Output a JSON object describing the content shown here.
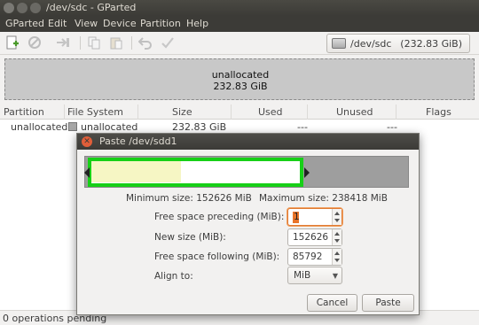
{
  "window": {
    "title": "/dev/sdc - GParted"
  },
  "menu": [
    "GParted",
    "Edit",
    "View",
    "Device",
    "Partition",
    "Help"
  ],
  "toolbar": {
    "icons": [
      "new-partition-icon",
      "delete-icon",
      "resize-move-icon",
      "copy-icon",
      "paste-icon",
      "undo-icon",
      "apply-icon"
    ],
    "device": "/dev/sdc",
    "device_size": "(232.83 GiB)"
  },
  "partition_map": {
    "label": "unallocated",
    "size": "232.83 GiB"
  },
  "table": {
    "headers": [
      "Partition",
      "File System",
      "Size",
      "Used",
      "Unused",
      "Flags"
    ],
    "rows": [
      {
        "partition": "unallocated",
        "filesystem": "unallocated",
        "size": "232.83 GiB",
        "used": "---",
        "unused": "---",
        "flags": ""
      }
    ]
  },
  "status": "0 operations pending",
  "dialog": {
    "title": "Paste /dev/sdd1",
    "min_size": "Minimum size: 152626 MiB",
    "max_size": "Maximum size: 238418 MiB",
    "fields": {
      "preceding_label": "Free space preceding (MiB):",
      "preceding_value": "1",
      "newsize_label": "New size (MiB):",
      "newsize_value": "152626",
      "following_label": "Free space following (MiB):",
      "following_value": "85792",
      "align_label": "Align to:",
      "align_value": "MiB"
    },
    "cancel": "Cancel",
    "paste": "Paste",
    "colors": {
      "selection": "#17d017",
      "used": "#f6f6c4",
      "free": "#9e9e9e"
    }
  }
}
